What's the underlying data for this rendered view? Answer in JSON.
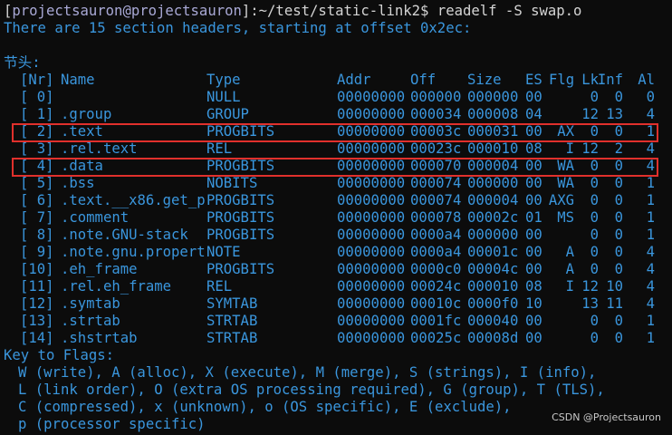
{
  "prompt": {
    "user_host": "projectsauron@projectsauron",
    "open_bracket": "[",
    "close_bracket": "]",
    "separator": ":",
    "path": "~/test/static-link2",
    "symbol": "$",
    "command": " readelf -S swap.o"
  },
  "summary": "There are 15 section headers, starting at offset 0x2ec:",
  "section_label": "节头:",
  "table": {
    "headers": [
      "[Nr]",
      "Name",
      "Type",
      "Addr",
      "Off",
      "Size",
      "ES",
      "Flg",
      "Lk",
      "Inf",
      "Al"
    ],
    "rows": [
      [
        "[ 0]",
        "",
        "NULL",
        "00000000",
        "000000",
        "000000",
        "00",
        "",
        "0",
        "0",
        "0"
      ],
      [
        "[ 1]",
        ".group",
        "GROUP",
        "00000000",
        "000034",
        "000008",
        "04",
        "",
        "12",
        "13",
        "4"
      ],
      [
        "[ 2]",
        ".text",
        "PROGBITS",
        "00000000",
        "00003c",
        "000031",
        "00",
        "AX",
        "0",
        "0",
        "1"
      ],
      [
        "[ 3]",
        ".rel.text",
        "REL",
        "00000000",
        "00023c",
        "000010",
        "08",
        "I",
        "12",
        "2",
        "4"
      ],
      [
        "[ 4]",
        ".data",
        "PROGBITS",
        "00000000",
        "000070",
        "000004",
        "00",
        "WA",
        "0",
        "0",
        "4"
      ],
      [
        "[ 5]",
        ".bss",
        "NOBITS",
        "00000000",
        "000074",
        "000000",
        "00",
        "WA",
        "0",
        "0",
        "1"
      ],
      [
        "[ 6]",
        ".text.__x86.get_p",
        "PROGBITS",
        "00000000",
        "000074",
        "000004",
        "00",
        "AXG",
        "0",
        "0",
        "1"
      ],
      [
        "[ 7]",
        ".comment",
        "PROGBITS",
        "00000000",
        "000078",
        "00002c",
        "01",
        "MS",
        "0",
        "0",
        "1"
      ],
      [
        "[ 8]",
        ".note.GNU-stack",
        "PROGBITS",
        "00000000",
        "0000a4",
        "000000",
        "00",
        "",
        "0",
        "0",
        "1"
      ],
      [
        "[ 9]",
        ".note.gnu.propert",
        "NOTE",
        "00000000",
        "0000a4",
        "00001c",
        "00",
        "A",
        "0",
        "0",
        "4"
      ],
      [
        "[10]",
        ".eh_frame",
        "PROGBITS",
        "00000000",
        "0000c0",
        "00004c",
        "00",
        "A",
        "0",
        "0",
        "4"
      ],
      [
        "[11]",
        ".rel.eh_frame",
        "REL",
        "00000000",
        "00024c",
        "000010",
        "08",
        "I",
        "12",
        "10",
        "4"
      ],
      [
        "[12]",
        ".symtab",
        "SYMTAB",
        "00000000",
        "00010c",
        "0000f0",
        "10",
        "",
        "13",
        "11",
        "4"
      ],
      [
        "[13]",
        ".strtab",
        "STRTAB",
        "00000000",
        "0001fc",
        "000040",
        "00",
        "",
        "0",
        "0",
        "1"
      ],
      [
        "[14]",
        ".shstrtab",
        "STRTAB",
        "00000000",
        "00025c",
        "00008d",
        "00",
        "",
        "0",
        "0",
        "1"
      ]
    ]
  },
  "flags": {
    "title": "Key to Flags:",
    "lines": [
      "W (write), A (alloc), X (execute), M (merge), S (strings), I (info),",
      "L (link order), O (extra OS processing required), G (group), T (TLS),",
      "C (compressed), x (unknown), o (OS specific), E (exclude),",
      "p (processor specific)"
    ]
  },
  "watermark": "CSDN @Projectsauron",
  "colors": {
    "background": "#0c0c0c",
    "text": "#3a96dd",
    "prompt_user": "#a9a9d6",
    "prompt_text": "#d4d4d4",
    "highlight_box": "#e0302c"
  }
}
